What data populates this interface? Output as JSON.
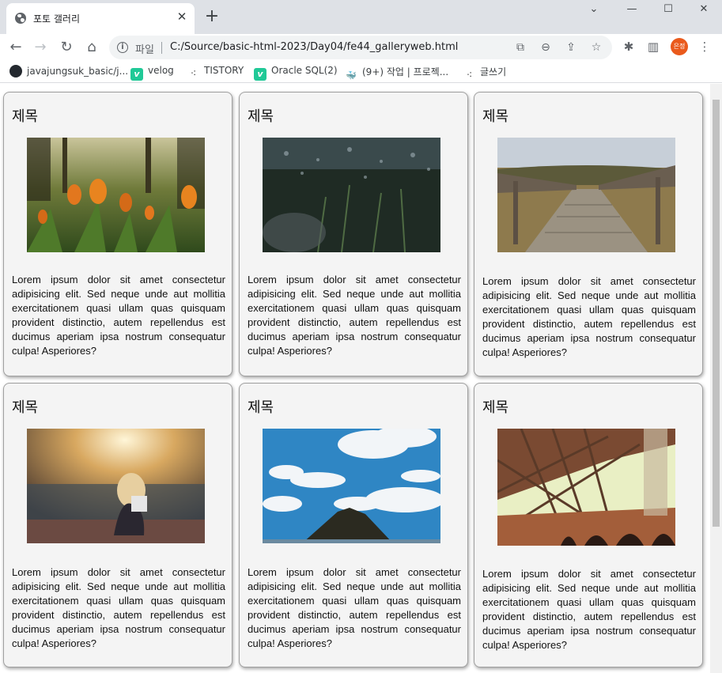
{
  "browser": {
    "tab_title": "포토 갤러리",
    "new_tab": "+",
    "address_label": "파일",
    "address_url": "C:/Source/basic-html-2023/Day04/fe44_galleryweb.html",
    "profile_initials": "은정",
    "window_controls": {
      "menu": "⌄",
      "minimize": "—",
      "maximize": "☐",
      "close": "✕"
    },
    "bookmarks": [
      {
        "label": "javajungsuk_basic/j...",
        "icon": "github-icon"
      },
      {
        "label": "velog",
        "icon": "velog-icon"
      },
      {
        "label": "TISTORY",
        "icon": "tistory-icon"
      },
      {
        "label": "Oracle SQL(2)",
        "icon": "velog-icon"
      },
      {
        "label": "(9+) 작업 | 프로젝...",
        "icon": "whale-icon"
      },
      {
        "label": "글쓰기",
        "icon": "tistory-icon"
      }
    ]
  },
  "gallery": {
    "cards": [
      {
        "title": "제목",
        "image": "tulips-photo",
        "text": "Lorem ipsum dolor sit amet consectetur adipisicing elit. Sed neque unde aut mollitia exercitationem quasi ullam quas quisquam provident distinctio, autem repellendus est ducimus aperiam ipsa nostrum consequatur culpa! Asperiores?"
      },
      {
        "title": "제목",
        "image": "snowy-plants-photo",
        "text": "Lorem ipsum dolor sit amet consectetur adipisicing elit. Sed neque unde aut mollitia exercitationem quasi ullam quas quisquam provident distinctio, autem repellendus est ducimus aperiam ipsa nostrum consequatur culpa! Asperiores?"
      },
      {
        "title": "제목",
        "image": "boardwalk-photo",
        "text": "Lorem ipsum dolor sit amet consectetur adipisicing elit. Sed neque unde aut mollitia exercitationem quasi ullam quas quisquam provident distinctio, autem repellendus est ducimus aperiam ipsa nostrum consequatur culpa! Asperiores?"
      },
      {
        "title": "제목",
        "image": "sunset-girl-photo",
        "text": "Lorem ipsum dolor sit amet consectetur adipisicing elit. Sed neque unde aut mollitia exercitationem quasi ullam quas quisquam provident distinctio, autem repellendus est ducimus aperiam ipsa nostrum consequatur culpa! Asperiores?"
      },
      {
        "title": "제목",
        "image": "sky-hill-photo",
        "text": "Lorem ipsum dolor sit amet consectetur adipisicing elit. Sed neque unde aut mollitia exercitationem quasi ullam quas quisquam provident distinctio, autem repellendus est ducimus aperiam ipsa nostrum consequatur culpa! Asperiores?"
      },
      {
        "title": "제목",
        "image": "bridge-photo",
        "text": "Lorem ipsum dolor sit amet consectetur adipisicing elit. Sed neque unde aut mollitia exercitationem quasi ullam quas quisquam provident distinctio, autem repellendus est ducimus aperiam ipsa nostrum consequatur culpa! Asperiores?"
      }
    ]
  }
}
